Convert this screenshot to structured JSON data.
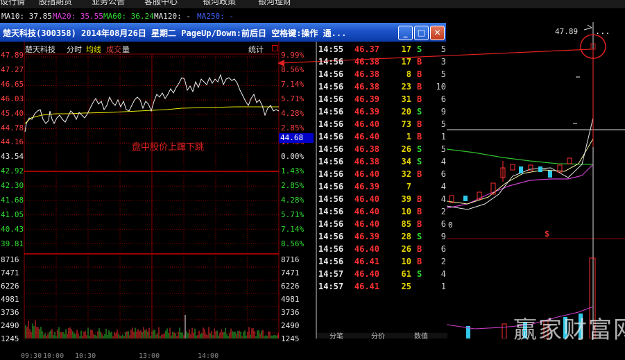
{
  "menu": [
    {
      "label": "设行情"
    },
    {
      "label": "股指期货"
    },
    {
      "label": "业务公告"
    },
    {
      "label": "客服中心"
    },
    {
      "label": "银河政策"
    },
    {
      "label": "银河理财"
    }
  ],
  "ma_bar": [
    {
      "label": "MA10: 37.85",
      "color": "#e8e8e8"
    },
    {
      "label": "MA20: 35.55",
      "color": "#e040e0"
    },
    {
      "label": "MA60: 36.24",
      "color": "#30e030"
    },
    {
      "label": "MA120: -",
      "color": "#e8e8e8"
    },
    {
      "label": "MA250: -",
      "color": "#4060ff"
    }
  ],
  "window": {
    "title": "楚天科技(300358) 2014年08月26日 星期二 PageUp/Down:前后日 空格键:操作 通...",
    "buttons": {
      "minimize": "_",
      "maximize": "□",
      "close": "✕"
    }
  },
  "intraday": {
    "stock_name": "楚天科技",
    "tabs": [
      {
        "label": "分时",
        "color": "#e0e0e0"
      },
      {
        "label": "均线",
        "color": "#e8e800"
      },
      {
        "label": "成交",
        "color": "#e04040"
      },
      {
        "label": "量",
        "color": "#e0e0e0"
      }
    ],
    "stat_label": "统计",
    "annotation": "盘中股价上蹿下跳",
    "current_price": "44.68",
    "price_labels_left": [
      {
        "text": "47.89",
        "color": "#ff4040"
      },
      {
        "text": "47.27",
        "color": "#ff4040"
      },
      {
        "text": "46.65",
        "color": "#ff4040"
      },
      {
        "text": "46.03",
        "color": "#ff4040"
      },
      {
        "text": "45.40",
        "color": "#ff4040"
      },
      {
        "text": "44.78",
        "color": "#ff4040"
      },
      {
        "text": "44.16",
        "color": "#ff4040"
      },
      {
        "text": "43.54",
        "color": "#e8e8e8"
      },
      {
        "text": "42.92",
        "color": "#30e030"
      },
      {
        "text": "42.30",
        "color": "#30e030"
      },
      {
        "text": "41.68",
        "color": "#30e030"
      },
      {
        "text": "41.05",
        "color": "#30e030"
      },
      {
        "text": "40.43",
        "color": "#30e030"
      },
      {
        "text": "39.81",
        "color": "#30e030"
      }
    ],
    "pct_labels_right": [
      {
        "text": "9.99%",
        "color": "#ff4040"
      },
      {
        "text": "8.56%",
        "color": "#ff4040"
      },
      {
        "text": "7.14%",
        "color": "#ff4040"
      },
      {
        "text": "5.71%",
        "color": "#ff4040"
      },
      {
        "text": "4.28%",
        "color": "#ff4040"
      },
      {
        "text": "2.85%",
        "color": "#ff4040"
      },
      {
        "text": "1.43%",
        "color": "#ff4040"
      },
      {
        "text": "0.00%",
        "color": "#e8e8e8"
      },
      {
        "text": "1.43%",
        "color": "#30e030"
      },
      {
        "text": "2.85%",
        "color": "#30e030"
      },
      {
        "text": "4.28%",
        "color": "#30e030"
      },
      {
        "text": "5.71%",
        "color": "#30e030"
      },
      {
        "text": "7.14%",
        "color": "#30e030"
      },
      {
        "text": "8.56%",
        "color": "#30e030"
      }
    ],
    "volume_labels": [
      "8716",
      "7471",
      "6226",
      "4981",
      "3736",
      "2490",
      "1245"
    ],
    "time_labels": [
      "09:30",
      "10:00",
      "10:30",
      "13:00",
      "14:00"
    ]
  },
  "ticks": [
    {
      "time": "14:55",
      "price": "46.37",
      "vol": "17",
      "bs": "S",
      "cnt": "5"
    },
    {
      "time": "14:56",
      "price": "46.38",
      "vol": "17",
      "bs": "B",
      "cnt": "3"
    },
    {
      "time": "14:56",
      "price": "46.38",
      "vol": "8",
      "bs": "B",
      "cnt": "5"
    },
    {
      "time": "14:56",
      "price": "46.38",
      "vol": "23",
      "bs": "B",
      "cnt": "10"
    },
    {
      "time": "14:56",
      "price": "46.39",
      "vol": "31",
      "bs": "B",
      "cnt": "6"
    },
    {
      "time": "14:56",
      "price": "46.39",
      "vol": "20",
      "bs": "S",
      "cnt": "9"
    },
    {
      "time": "14:56",
      "price": "46.40",
      "vol": "73",
      "bs": "B",
      "cnt": "5"
    },
    {
      "time": "14:56",
      "price": "46.40",
      "vol": "1",
      "bs": "B",
      "cnt": "1"
    },
    {
      "time": "14:56",
      "price": "46.38",
      "vol": "26",
      "bs": "S",
      "cnt": "5"
    },
    {
      "time": "14:56",
      "price": "46.38",
      "vol": "34",
      "bs": "S",
      "cnt": "4"
    },
    {
      "time": "14:56",
      "price": "46.40",
      "vol": "32",
      "bs": "B",
      "cnt": "6"
    },
    {
      "time": "14:56",
      "price": "46.39",
      "vol": "7",
      "bs": "",
      "cnt": "4"
    },
    {
      "time": "14:56",
      "price": "46.40",
      "vol": "39",
      "bs": "B",
      "cnt": "4"
    },
    {
      "time": "14:56",
      "price": "46.40",
      "vol": "10",
      "bs": "B",
      "cnt": "2"
    },
    {
      "time": "14:56",
      "price": "46.40",
      "vol": "85",
      "bs": "B",
      "cnt": "6"
    },
    {
      "time": "14:56",
      "price": "46.39",
      "vol": "28",
      "bs": "S",
      "cnt": "9"
    },
    {
      "time": "14:56",
      "price": "46.40",
      "vol": "26",
      "bs": "B",
      "cnt": "6"
    },
    {
      "time": "14:56",
      "price": "46.41",
      "vol": "10",
      "bs": "B",
      "cnt": "2"
    },
    {
      "time": "14:57",
      "price": "46.40",
      "vol": "61",
      "bs": "S",
      "cnt": "4"
    },
    {
      "time": "14:57",
      "price": "46.41",
      "vol": "25",
      "bs": "",
      "cnt": "1"
    }
  ],
  "tick_tabs": [
    "分笔",
    "分价",
    "数值"
  ],
  "right_chart": {
    "high_label": "47.89",
    "menu_dots": "...",
    "zero_label": "0",
    "signal_mark": "$",
    "watermark": "赢家财富网"
  },
  "colors": {
    "up": "#ff3030",
    "down": "#30e030",
    "flat": "#e8e8e8",
    "grid": "#8b0000",
    "price_line": "#f0f0f0",
    "avg_line": "#e8e800"
  }
}
